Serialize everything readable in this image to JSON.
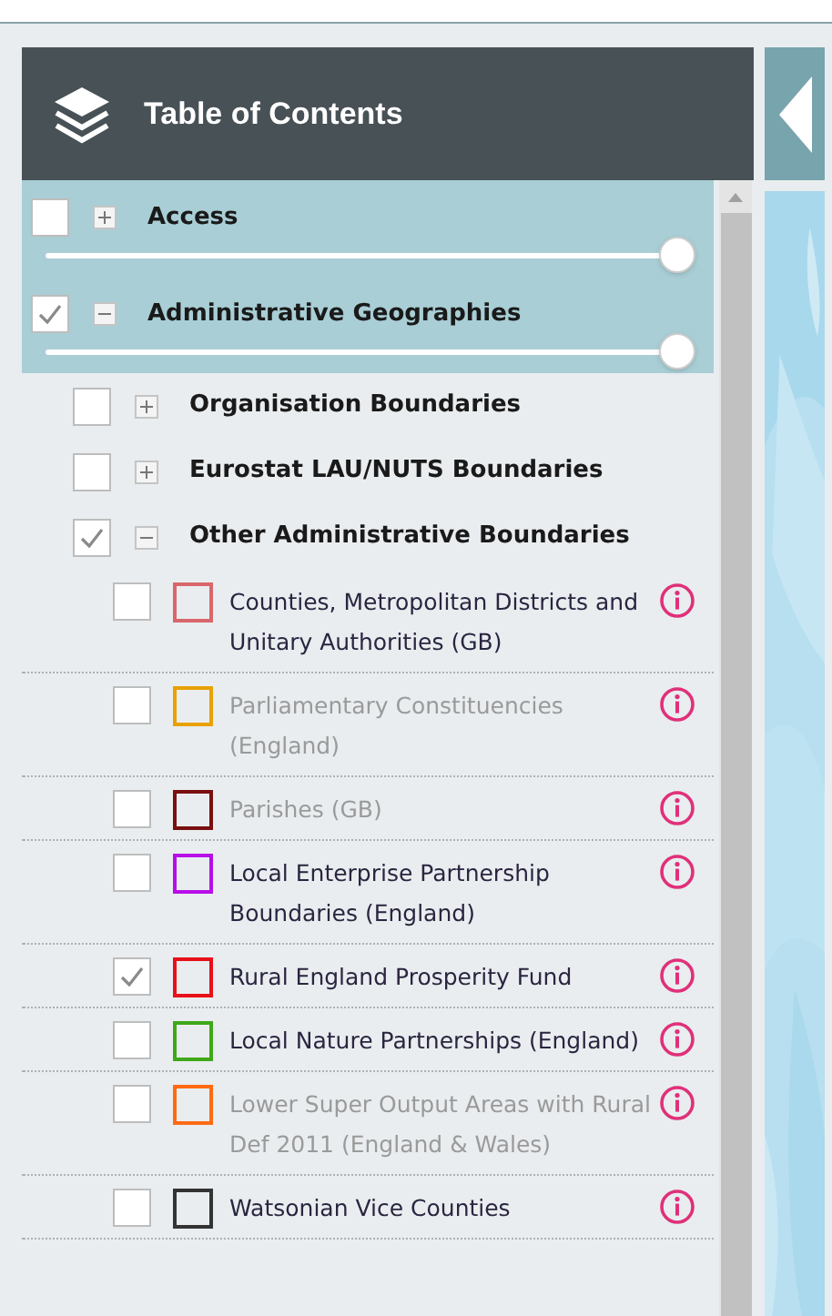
{
  "panel": {
    "title": "Table of Contents"
  },
  "groups": [
    {
      "label": "Access",
      "checked": false,
      "expanded": false,
      "level": 1
    },
    {
      "label": "Administrative Geographies",
      "checked": true,
      "expanded": true,
      "level": 1,
      "children": [
        {
          "label": "Organisation Boundaries",
          "checked": false,
          "expanded": false
        },
        {
          "label": "Eurostat LAU/NUTS Boundaries",
          "checked": false,
          "expanded": false
        },
        {
          "label": "Other Administrative Boundaries",
          "checked": true,
          "expanded": true,
          "children": [
            {
              "label": "Counties, Metropolitan Districts and Unitary Authorities (GB)",
              "checked": false,
              "disabled": false,
              "color": "#d9666b"
            },
            {
              "label": "Parliamentary Constituencies (England)",
              "checked": false,
              "disabled": true,
              "color": "#e8a100"
            },
            {
              "label": "Parishes (GB)",
              "checked": false,
              "disabled": true,
              "color": "#7a0f0f"
            },
            {
              "label": "Local Enterprise Partnership Boundaries (England)",
              "checked": false,
              "disabled": false,
              "color": "#b70ee8"
            },
            {
              "label": "Rural England Prosperity Fund",
              "checked": true,
              "disabled": false,
              "color": "#e8101a"
            },
            {
              "label": "Local Nature Partnerships (England)",
              "checked": false,
              "disabled": false,
              "color": "#3fa818"
            },
            {
              "label": "Lower Super Output Areas with Rural Def 2011 (England & Wales)",
              "checked": false,
              "disabled": true,
              "color": "#ff6a13"
            },
            {
              "label": "Watsonian Vice Counties",
              "checked": false,
              "disabled": false,
              "color": "#333333"
            }
          ]
        }
      ]
    }
  ]
}
